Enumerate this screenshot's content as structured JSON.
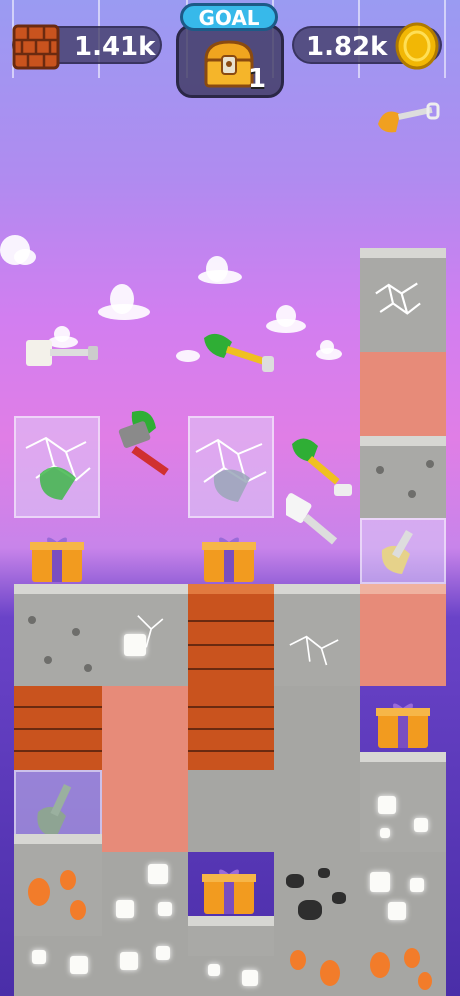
{
  "hud": {
    "bricks_count": "1.41k",
    "goal_label": "GOAL",
    "goal_count": "1",
    "coins_count": "1.82k"
  },
  "icons": {
    "bricks": "brick-stack-icon",
    "chest": "treasure-chest-icon",
    "coin": "gold-coin-icon"
  },
  "colors": {
    "goal_tag": "#37b9ea",
    "coin": "#f2b705",
    "brick": "#c9531e",
    "clay": "#e78b79",
    "stone": "#a9a9a6"
  }
}
